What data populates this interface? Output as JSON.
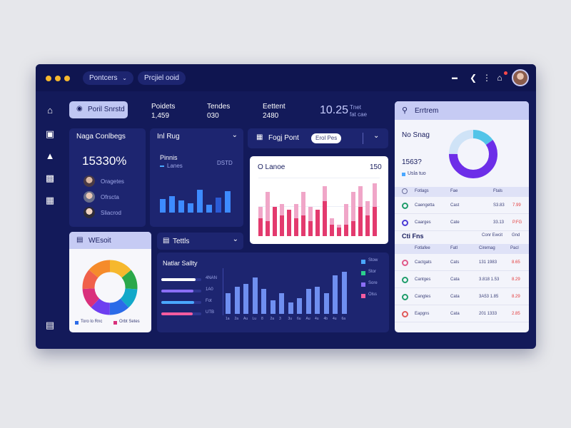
{
  "app": {
    "crumbs": [
      "Pontcers",
      "Prcjiel ooid"
    ]
  },
  "primary_button": "Poril Snrstd",
  "stats": [
    {
      "label": "Poidets",
      "value": "1,459"
    },
    {
      "label": "Tendes",
      "value": "030"
    },
    {
      "label": "Eettent",
      "value": "2480"
    }
  ],
  "big_stat": {
    "value": "10.25",
    "sub1": "Tnet",
    "sub2": "fat cae"
  },
  "search": {
    "value": "Errtrem"
  },
  "page_card": {
    "title": "Naga Conlbegs",
    "metric": "15330%",
    "people": [
      "Oragetes",
      "Ofrscta",
      "Sliacrod"
    ]
  },
  "trend_card": {
    "title": "Inl Rug",
    "sub": "Pinnis",
    "sub2": "Lanes",
    "sub3": "DSTD",
    "bars": [
      0.5,
      0.6,
      0.45,
      0.35,
      0.85,
      0.3,
      0.55,
      0.8
    ]
  },
  "progress_card": {
    "title": "Fogj Pont",
    "pill": "Erol Pes",
    "panel_title": "O Lanoe",
    "panel_value": "150",
    "pink": [
      0.5,
      0.75,
      0.4,
      0.55,
      0.35,
      0.55,
      0.75,
      0.5,
      0.4,
      0.85,
      0.3,
      0.2,
      0.55,
      0.75,
      0.85,
      0.6,
      0.9
    ],
    "red": [
      0.3,
      0.25,
      0.5,
      0.35,
      0.45,
      0.3,
      0.35,
      0.25,
      0.45,
      0.6,
      0.2,
      0.15,
      0.2,
      0.25,
      0.5,
      0.35,
      0.5
    ]
  },
  "donut_card_left": {
    "title": "WEsoit",
    "legend": [
      "Toro lo Rnc",
      "Orbt Setes"
    ],
    "segments": [
      {
        "value": 14,
        "color": "#f6b82e"
      },
      {
        "value": 12,
        "color": "#2ba84a"
      },
      {
        "value": 12,
        "color": "#12a8c9"
      },
      {
        "value": 12,
        "color": "#2b6be8"
      },
      {
        "value": 12,
        "color": "#6e3ef0"
      },
      {
        "value": 12,
        "color": "#d9307c"
      },
      {
        "value": 12,
        "color": "#f0604a"
      },
      {
        "value": 14,
        "color": "#f58b2b"
      }
    ]
  },
  "tasks_card": {
    "title": "Tettls",
    "chart_label": "Natlar Sallty",
    "hbars": [
      {
        "label": "4NAN",
        "fill": 0.85,
        "color": "#ffffff"
      },
      {
        "label": "1A0",
        "fill": 0.8,
        "color": "#8b6ef5"
      },
      {
        "label": "Fot",
        "fill": 0.82,
        "color": "#4aa7ff"
      },
      {
        "label": "UTB",
        "fill": 0.78,
        "color": "#f45ca0"
      }
    ],
    "vbars": [
      0.45,
      0.6,
      0.65,
      0.8,
      0.55,
      0.3,
      0.45,
      0.25,
      0.35,
      0.55,
      0.6,
      0.45,
      0.85,
      0.92
    ],
    "vbar_labels": [
      "1a",
      "2a",
      "Au",
      "Lu",
      "8",
      "2a",
      "3",
      "3u",
      "6u",
      "Au",
      "4u",
      "4b",
      "4u",
      "6a"
    ],
    "legend": [
      {
        "label": "Stow",
        "color": "#4aa7ff"
      },
      {
        "label": "Stor",
        "color": "#2ccf8d"
      },
      {
        "label": "Sore",
        "color": "#8b6ef5"
      },
      {
        "label": "Olss",
        "color": "#f45ca0"
      }
    ]
  },
  "right_panel": {
    "title": "No Snag",
    "value": "1563?",
    "legend": "Usla tuo",
    "donut": [
      {
        "value": 15,
        "color": "#52c4e8"
      },
      {
        "value": 60,
        "color": "#6d2ee8"
      },
      {
        "value": 25,
        "color": "#cfe3f7"
      }
    ],
    "table1": {
      "headers": [
        "Fotlags",
        "Fae",
        "Ftals"
      ],
      "rows": [
        {
          "name": "Caengetta",
          "c1": "Cast",
          "c2": "S3.83",
          "c3": "7.99",
          "icon": "#1f9d6b"
        },
        {
          "name": "Caarges",
          "c1": "Cate",
          "c2": "33.13",
          "c3": "P.FG",
          "icon": "#4b3bd6"
        }
      ]
    },
    "section": "Cti Fns",
    "section_link": "Conr Ewcit",
    "section_extra": "Gnd",
    "table2": {
      "headers": [
        "Fotlafee",
        "Fatl",
        "Ciremag",
        "Pacl"
      ],
      "rows": [
        {
          "name": "Cactgats",
          "c1": "Cats",
          "c2": "131 1983",
          "c3": "8.65",
          "icon": "#e05a8a"
        },
        {
          "name": "Cantges",
          "c1": "Cata",
          "c2": "3.818 1.53",
          "c3": "8.29",
          "icon": "#1f9d6b"
        },
        {
          "name": "Cangtes",
          "c1": "Cata",
          "c2": "3A53 1.85",
          "c3": "8.29",
          "icon": "#1f9d6b"
        },
        {
          "name": "Eapgns",
          "c1": "Cata",
          "c2": "201 1333",
          "c3": "2.85",
          "icon": "#e05a5a"
        }
      ]
    }
  }
}
